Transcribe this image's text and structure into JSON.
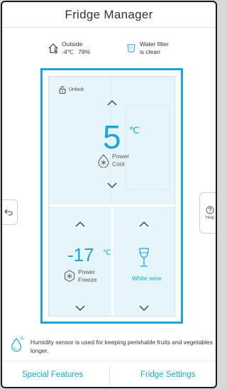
{
  "app": {
    "title": "Fridge Manager"
  },
  "outside": {
    "label": "Outside",
    "temp": "-4℃",
    "humidity": "79%",
    "icon": "house-thermometer-icon"
  },
  "water_filter": {
    "line1": "Water filter",
    "line2": "is clean",
    "icon": "water-filter-icon"
  },
  "fridge": {
    "lock_label": "Unlock",
    "fridge_temp": "5",
    "fridge_unit": "℃",
    "fridge_mode_line1": "Power",
    "fridge_mode_line2": "Cool",
    "freezer_temp": "-17",
    "freezer_unit": "℃",
    "freezer_mode_line1": "Power",
    "freezer_mode_line2": "Freeze",
    "flex_zone_label": "White wine"
  },
  "side": {
    "help_label": "Help"
  },
  "note": {
    "text": "Humidity sensor is used for keeping perishable fruits and vegetables longer.",
    "icon": "humidity-drop-icon"
  },
  "footer": {
    "special_features": "Special Features",
    "fridge_settings": "Fridge Settings"
  },
  "colors": {
    "accent": "#1ea6d6",
    "fridge_bg": "#e6f4fb",
    "text": "#333333"
  }
}
